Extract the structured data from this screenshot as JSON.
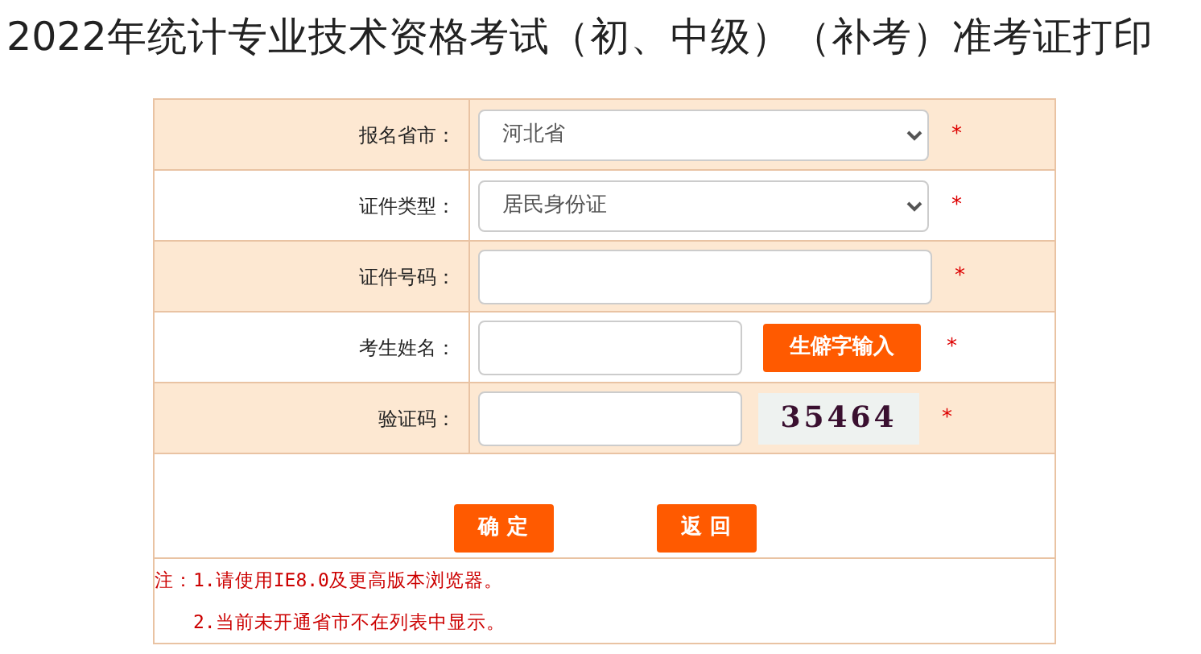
{
  "title": "2022年统计专业技术资格考试（初、中级）（补考）准考证打印",
  "fields": [
    {
      "kind": "select",
      "label": "报名省市：",
      "value": "河北省",
      "mark": "*"
    },
    {
      "kind": "select",
      "label": "证件类型：",
      "value": "居民身份证",
      "mark": "*"
    },
    {
      "kind": "input",
      "label": "证件号码：",
      "mark": "*"
    },
    {
      "kind": "input_button",
      "label": "考生姓名：",
      "button": "生僻字输入",
      "mark": "*"
    },
    {
      "kind": "captcha",
      "label": "验证码：",
      "captcha": "35464",
      "mark": "*"
    }
  ],
  "buttons": [
    "确 定",
    "返 回"
  ],
  "notes": [
    "注：1.请使用IE8.0及更高版本浏览器。",
    "2.当前未开通省市不在列表中显示。"
  ]
}
